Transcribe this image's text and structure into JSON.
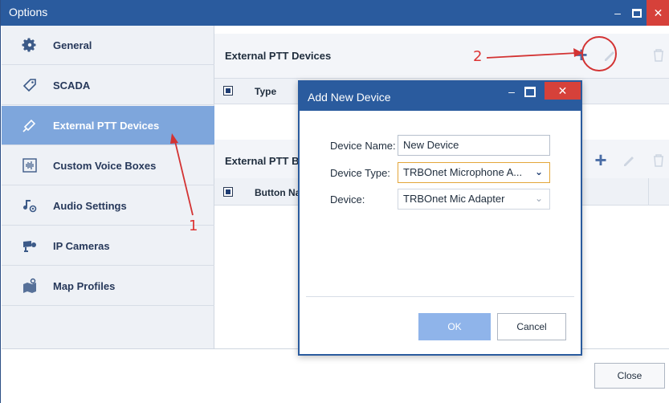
{
  "window": {
    "title": "Options"
  },
  "sidebar": {
    "items": [
      {
        "label": "General",
        "icon": "gear-icon",
        "active": false
      },
      {
        "label": "SCADA",
        "icon": "tag-icon",
        "active": false
      },
      {
        "label": "External PTT Devices",
        "icon": "ptt-device-icon",
        "active": true
      },
      {
        "label": "Custom Voice Boxes",
        "icon": "voice-box-icon",
        "active": false
      },
      {
        "label": "Audio Settings",
        "icon": "audio-settings-icon",
        "active": false
      },
      {
        "label": "IP Cameras",
        "icon": "camera-icon",
        "active": false
      },
      {
        "label": "Map Profiles",
        "icon": "map-icon",
        "active": false
      }
    ]
  },
  "sections": {
    "devices": {
      "title": "External PTT Devices",
      "col_type": "Type"
    },
    "buttons": {
      "title": "External PTT B",
      "col_button": "Button Na"
    }
  },
  "footer": {
    "close_label": "Close"
  },
  "dialog": {
    "title": "Add New Device",
    "device_name_label": "Device Name:",
    "device_name_value": "New Device",
    "device_type_label": "Device Type:",
    "device_type_value": "TRBOnet Microphone A...",
    "device_label": "Device:",
    "device_value": "TRBOnet Mic Adapter",
    "ok_label": "OK",
    "cancel_label": "Cancel"
  },
  "annotations": {
    "step1": "1",
    "step2": "2",
    "color": "#d33333"
  },
  "colors": {
    "titlebar": "#2a5b9e",
    "active_nav": "#7ea6dc",
    "close": "#d6413a",
    "ok_button": "#8fb4ea"
  }
}
